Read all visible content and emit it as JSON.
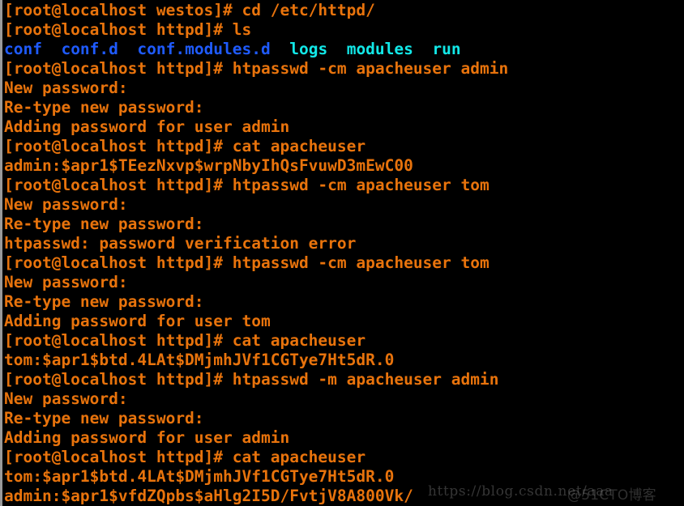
{
  "terminal": {
    "background_color": "#000000",
    "default_color": "#e8730c",
    "dir_color": "#1f5bff",
    "link_color": "#12e8e8",
    "prompt_root_httpd": "[root@localhost httpd]# ",
    "prompt_root_westos": "[root@localhost westos]# ",
    "lines": [
      {
        "id": 1,
        "segments": [
          {
            "text": "[root@localhost westos]# cd /etc/httpd/",
            "color": "orange"
          }
        ]
      },
      {
        "id": 2,
        "segments": [
          {
            "text": "[root@localhost httpd]# ls",
            "color": "orange"
          }
        ]
      },
      {
        "id": 3,
        "segments": [
          {
            "text": "conf",
            "color": "blue"
          },
          {
            "text": "  ",
            "color": "orange"
          },
          {
            "text": "conf.d",
            "color": "blue"
          },
          {
            "text": "  ",
            "color": "orange"
          },
          {
            "text": "conf.modules.d",
            "color": "blue"
          },
          {
            "text": "  ",
            "color": "orange"
          },
          {
            "text": "logs",
            "color": "cyan"
          },
          {
            "text": "  ",
            "color": "orange"
          },
          {
            "text": "modules",
            "color": "cyan"
          },
          {
            "text": "  ",
            "color": "orange"
          },
          {
            "text": "run",
            "color": "cyan"
          }
        ]
      },
      {
        "id": 4,
        "segments": [
          {
            "text": "[root@localhost httpd]# htpasswd -cm apacheuser admin",
            "color": "orange"
          }
        ]
      },
      {
        "id": 5,
        "segments": [
          {
            "text": "New password:",
            "color": "orange"
          }
        ]
      },
      {
        "id": 6,
        "segments": [
          {
            "text": "Re-type new password:",
            "color": "orange"
          }
        ]
      },
      {
        "id": 7,
        "segments": [
          {
            "text": "Adding password for user admin",
            "color": "orange"
          }
        ]
      },
      {
        "id": 8,
        "segments": [
          {
            "text": "[root@localhost httpd]# cat apacheuser",
            "color": "orange"
          }
        ]
      },
      {
        "id": 9,
        "segments": [
          {
            "text": "admin:$apr1$TEezNxvp$wrpNbyIhQsFvuwD3mEwC00",
            "color": "orange"
          }
        ]
      },
      {
        "id": 10,
        "segments": [
          {
            "text": "[root@localhost httpd]# htpasswd -cm apacheuser tom",
            "color": "orange"
          }
        ]
      },
      {
        "id": 11,
        "segments": [
          {
            "text": "New password:",
            "color": "orange"
          }
        ]
      },
      {
        "id": 12,
        "segments": [
          {
            "text": "Re-type new password:",
            "color": "orange"
          }
        ]
      },
      {
        "id": 13,
        "segments": [
          {
            "text": "htpasswd: password verification error",
            "color": "orange"
          }
        ]
      },
      {
        "id": 14,
        "segments": [
          {
            "text": "[root@localhost httpd]# htpasswd -cm apacheuser tom",
            "color": "orange"
          }
        ]
      },
      {
        "id": 15,
        "segments": [
          {
            "text": "New password:",
            "color": "orange"
          }
        ]
      },
      {
        "id": 16,
        "segments": [
          {
            "text": "Re-type new password:",
            "color": "orange"
          }
        ]
      },
      {
        "id": 17,
        "segments": [
          {
            "text": "Adding password for user tom",
            "color": "orange"
          }
        ]
      },
      {
        "id": 18,
        "segments": [
          {
            "text": "[root@localhost httpd]# cat apacheuser",
            "color": "orange"
          }
        ]
      },
      {
        "id": 19,
        "segments": [
          {
            "text": "tom:$apr1$btd.4LAt$DMjmhJVf1CGTye7Ht5dR.0",
            "color": "orange"
          }
        ]
      },
      {
        "id": 20,
        "segments": [
          {
            "text": "[root@localhost httpd]# htpasswd -m apacheuser admin",
            "color": "orange"
          }
        ]
      },
      {
        "id": 21,
        "segments": [
          {
            "text": "New password:",
            "color": "orange"
          }
        ]
      },
      {
        "id": 22,
        "segments": [
          {
            "text": "Re-type new password:",
            "color": "orange"
          }
        ]
      },
      {
        "id": 23,
        "segments": [
          {
            "text": "Adding password for user admin",
            "color": "orange"
          }
        ]
      },
      {
        "id": 24,
        "segments": [
          {
            "text": "[root@localhost httpd]# cat apacheuser",
            "color": "orange"
          }
        ]
      },
      {
        "id": 25,
        "segments": [
          {
            "text": "tom:$apr1$btd.4LAt$DMjmhJVf1CGTye7Ht5dR.0",
            "color": "orange"
          }
        ]
      },
      {
        "id": 26,
        "segments": [
          {
            "text": "admin:$apr1$vfdZQpbs$aHlg2I5D/FvtjV8A800Vk/",
            "color": "orange"
          }
        ]
      }
    ]
  },
  "watermarks": {
    "url": "https://blog.csdn.net/aaa",
    "csdn": "@51CTO博客"
  }
}
